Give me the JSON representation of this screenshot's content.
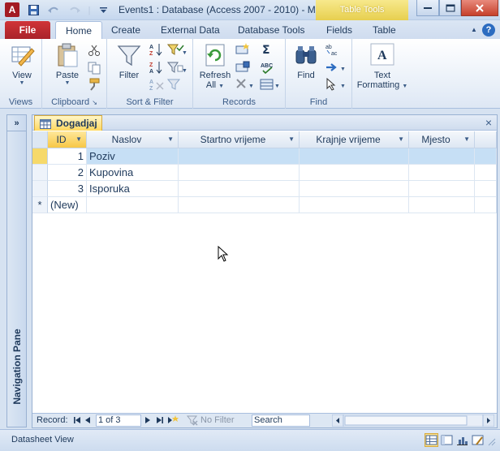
{
  "window": {
    "title": "Events1 : Database (Access 2007 - 2010)  -  M",
    "contextual_tab_group": "Table Tools",
    "app_icon_letter": "A"
  },
  "ribbon": {
    "file_tab": "File",
    "tabs": [
      "Home",
      "Create",
      "External Data",
      "Database Tools",
      "Fields",
      "Table"
    ],
    "active_tab": "Home",
    "help_label": "?",
    "groups": {
      "views": {
        "label": "Views",
        "view_button": "View"
      },
      "clipboard": {
        "label": "Clipboard",
        "paste_button": "Paste"
      },
      "sort_filter": {
        "label": "Sort & Filter",
        "filter_button": "Filter"
      },
      "records": {
        "label": "Records",
        "refresh_button_line1": "Refresh",
        "refresh_button_line2": "All"
      },
      "find": {
        "label": "Find",
        "find_button": "Find"
      },
      "text_formatting": {
        "button_line1": "Text",
        "button_line2": "Formatting"
      }
    }
  },
  "nav_pane": {
    "label": "Navigation Pane",
    "toggle": "»"
  },
  "document": {
    "tab_label": "Dogadjaj",
    "close": "×",
    "columns": [
      "ID",
      "Naslov",
      "Startno vrijeme",
      "Krajnje vrijeme",
      "Mjesto"
    ],
    "rows": [
      {
        "id": "1",
        "naslov": "Poziv",
        "start": "",
        "end": "",
        "mjesto": ""
      },
      {
        "id": "2",
        "naslov": "Kupovina",
        "start": "",
        "end": "",
        "mjesto": ""
      },
      {
        "id": "3",
        "naslov": "Isporuka",
        "start": "",
        "end": "",
        "mjesto": ""
      }
    ],
    "new_row_marker": "*",
    "new_row_label": "(New)"
  },
  "record_nav": {
    "label": "Record:",
    "position": "1 of 3",
    "filter_label": "No Filter",
    "search_placeholder": "Search"
  },
  "status_bar": {
    "text": "Datasheet View"
  }
}
